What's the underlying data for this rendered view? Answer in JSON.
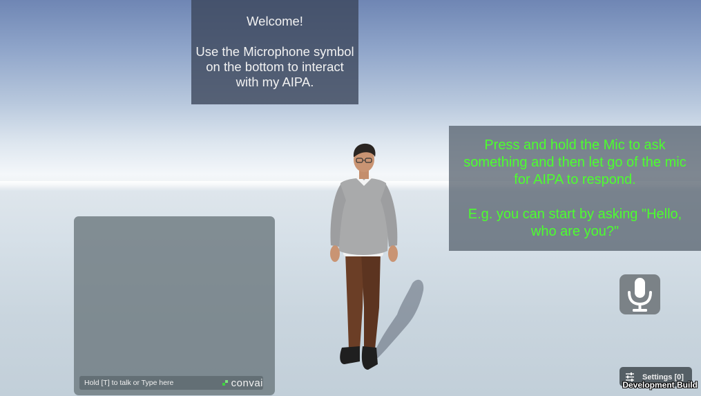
{
  "welcome": {
    "title": "Welcome!",
    "body": "Use the Microphone symbol\non the bottom to interact\nwith my AIPA."
  },
  "instruction": {
    "main": "Press and hold the Mic to ask\nsomething and then let go of the mic\nfor AIPA to respond.",
    "example": "E.g. you can start by asking \"Hello,\nwho are you?\"",
    "text_color": "#4cff2e"
  },
  "chat": {
    "placeholder": "Hold [T] to talk or Type here",
    "brand": "convai"
  },
  "mic": {
    "icon": "microphone-icon"
  },
  "settings": {
    "label": "Settings [0]",
    "icon": "sliders-icon"
  },
  "footer": {
    "build_label": "Development Build"
  }
}
